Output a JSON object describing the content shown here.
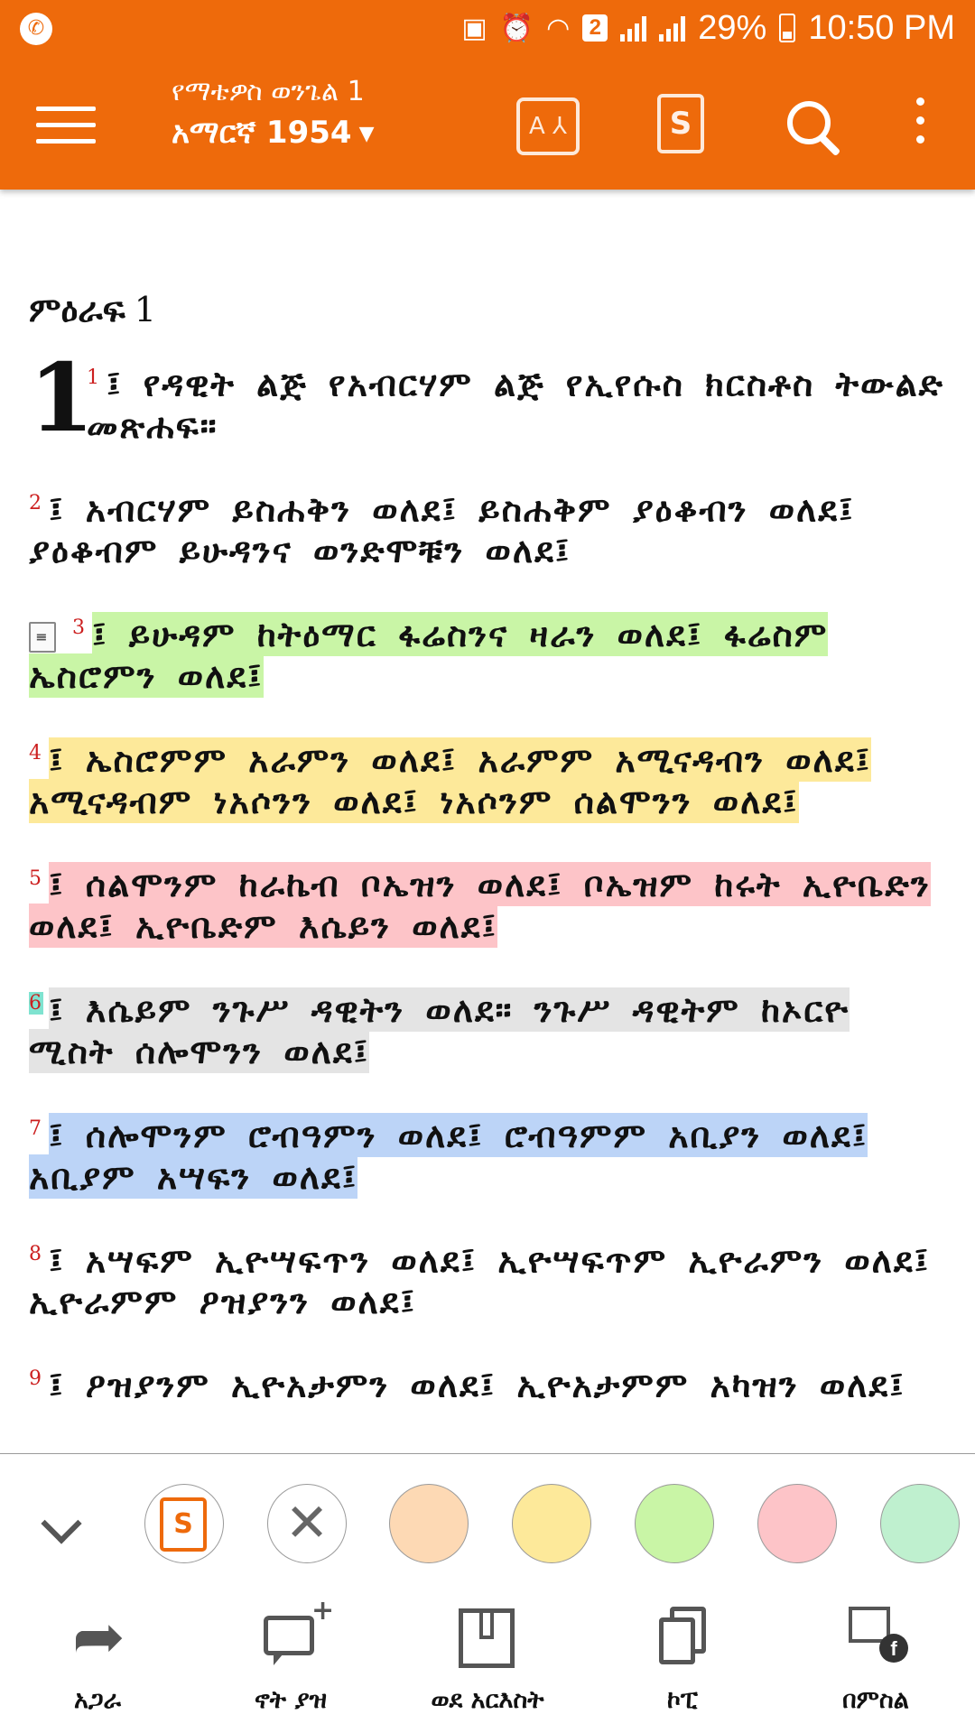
{
  "status_bar": {
    "sim": "2",
    "battery": "29%",
    "time": "10:50 PM"
  },
  "app_bar": {
    "book_title": "የማቴዎስ ወንጌል 1",
    "version": "አማርኛ 1954",
    "parallel_icon_text": "A ⅄",
    "s_icon_text": "S"
  },
  "content": {
    "chapter_label": "ምዕራፍ",
    "chapter_number": "1",
    "drop_number": "1",
    "verses": [
      {
        "n": "1",
        "text": "፤ የዳዊት ልጅ የአብርሃም ልጅ የኢየሱስ ክርስቶስ ትውልድ መጽሐፍ።",
        "highlight": ""
      },
      {
        "n": "2",
        "text": "፤ አብርሃም ይስሐቅን ወለደ፤ ይስሐቅም ያዕቆብን ወለደ፤ ያዕቆብም ይሁዳንና ወንድሞቹን ወለደ፤",
        "highlight": ""
      },
      {
        "n": "3",
        "text": "፤ ይሁዳም ከትዕማር ፋሬስንና ዛራን ወለደ፤ ፋሬስም ኤስሮምን ወለደ፤",
        "highlight": "#c9f5a6"
      },
      {
        "n": "4",
        "text": "፤ ኤስሮምም አራምን ወለደ፤ አራምም አሚናዳብን ወለደ፤ አሚናዳብም ነአሶንን ወለደ፤ ነአሶንም ሰልሞንን ወለደ፤",
        "highlight": "#fde99a"
      },
      {
        "n": "5",
        "text": "፤ ሰልሞንም ከራኬብ ቦኤዝን ወለደ፤ ቦኤዝም ከሩት ኢዮቤድን ወለደ፤ ኢዮቤድም እሴይን ወለደ፤",
        "highlight": "#fdc4c8"
      },
      {
        "n": "6",
        "text": "፤ እሴይም ንጉሥ ዳዊትን ወለደ። ንጉሥ ዳዊትም ከኦርዮ ሚስት ሰሎሞንን ወለደ፤",
        "highlight": "#e4e4e4"
      },
      {
        "n": "7",
        "text": "፤ ሰሎሞንም ሮብዓምን ወለደ፤ ሮብዓምም አቢያን ወለደ፤ አቢያም አሣፍን ወለደ፤",
        "highlight": "#bcd4f7"
      },
      {
        "n": "8",
        "text": "፤ አሣፍም ኢዮሣፍጥን ወለደ፤ ኢዮሣፍጥም ኢዮራምን ወለደ፤ ኢዮራምም ዖዝያንን ወለደ፤",
        "highlight": ""
      },
      {
        "n": "9",
        "text": "፤ ዖዝያንም ኢዮአታምን ወለደ፤ ኢዮአታምም አካዝን ወለደ፤",
        "highlight": ""
      }
    ]
  },
  "picker": {
    "colors": [
      "#fdd9b4",
      "#fde99a",
      "#c9f5a6",
      "#fdc4c8",
      "#bff0cf"
    ],
    "s_text": "S",
    "clear_glyph": "✕"
  },
  "actions": {
    "share": "አጋራ",
    "add_note": "ኖት ያዝ",
    "bookmark": "ወደ አርእስት",
    "copy": "ኮፒ",
    "as_image": "በምስል"
  }
}
